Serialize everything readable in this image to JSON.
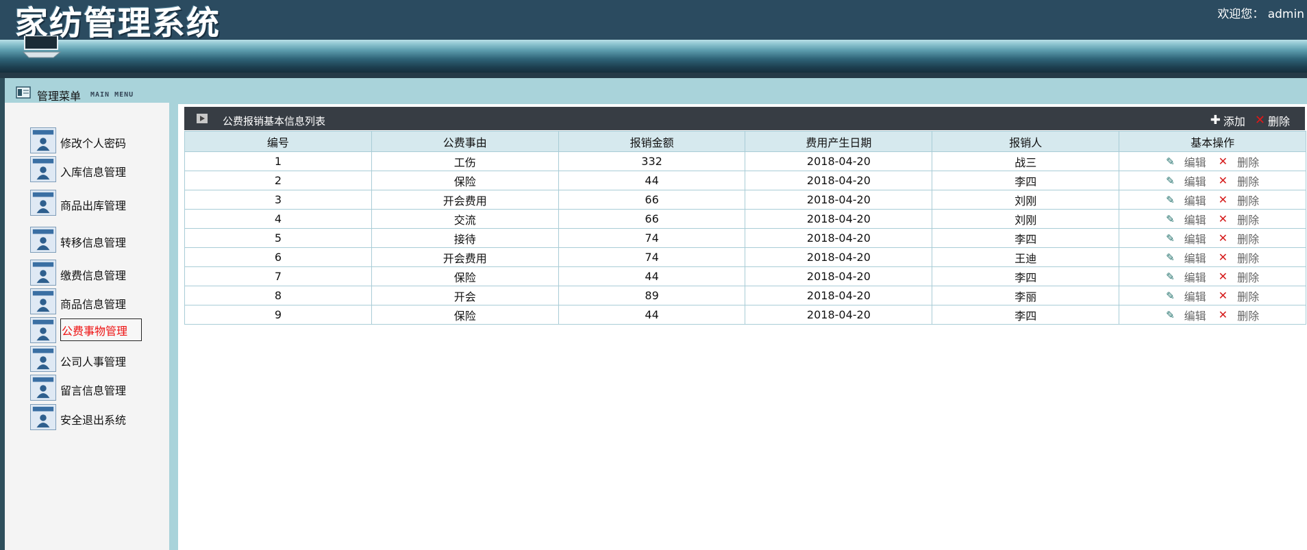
{
  "header": {
    "app_title": "家纺管理系统",
    "welcome_prefix": "欢迎您：",
    "username": "admin"
  },
  "menu": {
    "title": "管理菜单",
    "subtitle": "MAIN MENU"
  },
  "sidebar": {
    "items": [
      {
        "label": "修改个人密码"
      },
      {
        "label": "入库信息管理"
      },
      {
        "label": "商品出库管理"
      },
      {
        "label": "转移信息管理"
      },
      {
        "label": "缴费信息管理"
      },
      {
        "label": "商品信息管理"
      },
      {
        "label": "公费事物管理",
        "active": true
      },
      {
        "label": "公司人事管理"
      },
      {
        "label": "留言信息管理"
      },
      {
        "label": "安全退出系统"
      }
    ]
  },
  "list": {
    "title": "公费报销基本信息列表",
    "add_label": "添加",
    "delete_label": "删除",
    "columns": [
      "编号",
      "公费事由",
      "报销金额",
      "费用产生日期",
      "报销人",
      "基本操作"
    ],
    "edit_label": "编辑",
    "row_delete_label": "删除",
    "rows": [
      [
        "1",
        "工伤",
        "332",
        "2018-04-20",
        "战三"
      ],
      [
        "2",
        "保险",
        "44",
        "2018-04-20",
        "李四"
      ],
      [
        "3",
        "开会费用",
        "66",
        "2018-04-20",
        "刘刚"
      ],
      [
        "4",
        "交流",
        "66",
        "2018-04-20",
        "刘刚"
      ],
      [
        "5",
        "接待",
        "74",
        "2018-04-20",
        "李四"
      ],
      [
        "6",
        "开会费用",
        "74",
        "2018-04-20",
        "王迪"
      ],
      [
        "7",
        "保险",
        "44",
        "2018-04-20",
        "李四"
      ],
      [
        "8",
        "开会",
        "89",
        "2018-04-20",
        "李丽"
      ],
      [
        "9",
        "保险",
        "44",
        "2018-04-20",
        "李四"
      ]
    ]
  },
  "icons": {
    "header_monitor": "monitor-icon",
    "menu_head": "panel-icon",
    "sidebar_item": "user-window-icon",
    "list_bar": "play-icon",
    "add": "plus-icon",
    "delete": "x-icon",
    "edit": "pencil-icon"
  },
  "colors": {
    "header_bg": "#2b4b60",
    "frame_bg": "#a9d3da",
    "list_bar_bg": "#373d44",
    "table_head_bg": "#d6e9ee",
    "active_menu_text": "#ee1111",
    "delete_red": "#d51a1a"
  }
}
